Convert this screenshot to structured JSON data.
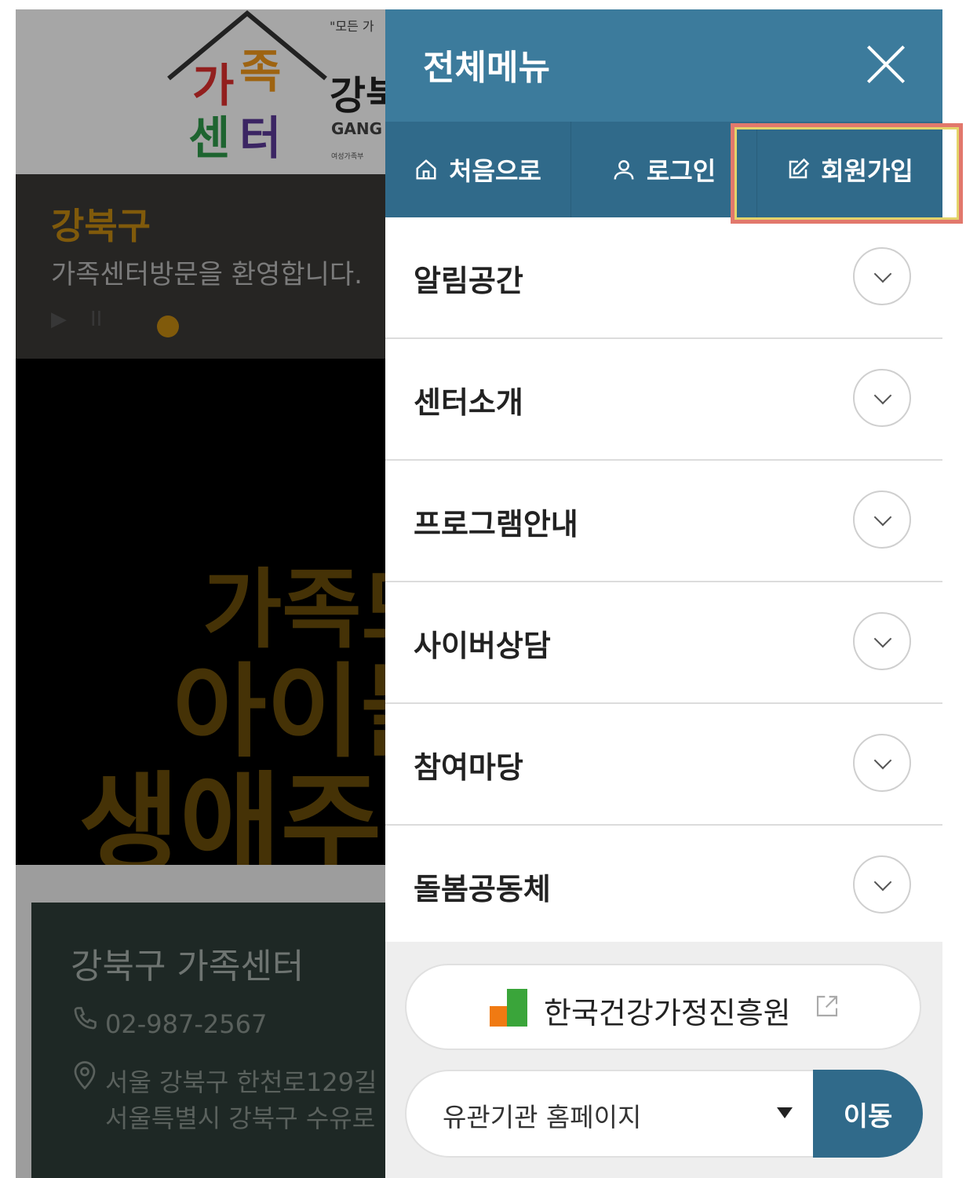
{
  "background_page": {
    "brand_tagline": "\"모든 가",
    "brand_name": "강북",
    "brand_en": "GANG",
    "brand_small": "여성가족부",
    "logo_chars": [
      "가",
      "족",
      "센",
      "터"
    ],
    "slogan_title": "강북구",
    "slogan_sub": "가족센터방문을 환영합니다.",
    "play_icon": "▶",
    "pause_icon": "II",
    "banner_lines": [
      "가족모",
      "아이들",
      "생애주"
    ],
    "info": {
      "title": "강북구 가족센터",
      "phone": "02-987-2567",
      "address_line1": "서울 강북구 한천로129길",
      "address_line2": "서울특별시 강북구 수유로"
    }
  },
  "menu": {
    "title": "전체메뉴",
    "quick_nav": [
      {
        "label": "처음으로",
        "icon": "home-icon"
      },
      {
        "label": "로그인",
        "icon": "user-icon"
      },
      {
        "label": "회원가입",
        "icon": "edit-icon"
      }
    ],
    "items": [
      {
        "label": "알림공간"
      },
      {
        "label": "센터소개"
      },
      {
        "label": "프로그램안내"
      },
      {
        "label": "사이버상담"
      },
      {
        "label": "참여마당"
      },
      {
        "label": "돌봄공동체"
      }
    ],
    "footer": {
      "kihf_label": "한국건강가정진흥원",
      "related_select_value": "유관기관 홈페이지",
      "go_label": "이동"
    }
  },
  "colors": {
    "menu_header": "#3c7b9c",
    "quick_nav": "#306a8a",
    "highlight": "#e2786c"
  }
}
